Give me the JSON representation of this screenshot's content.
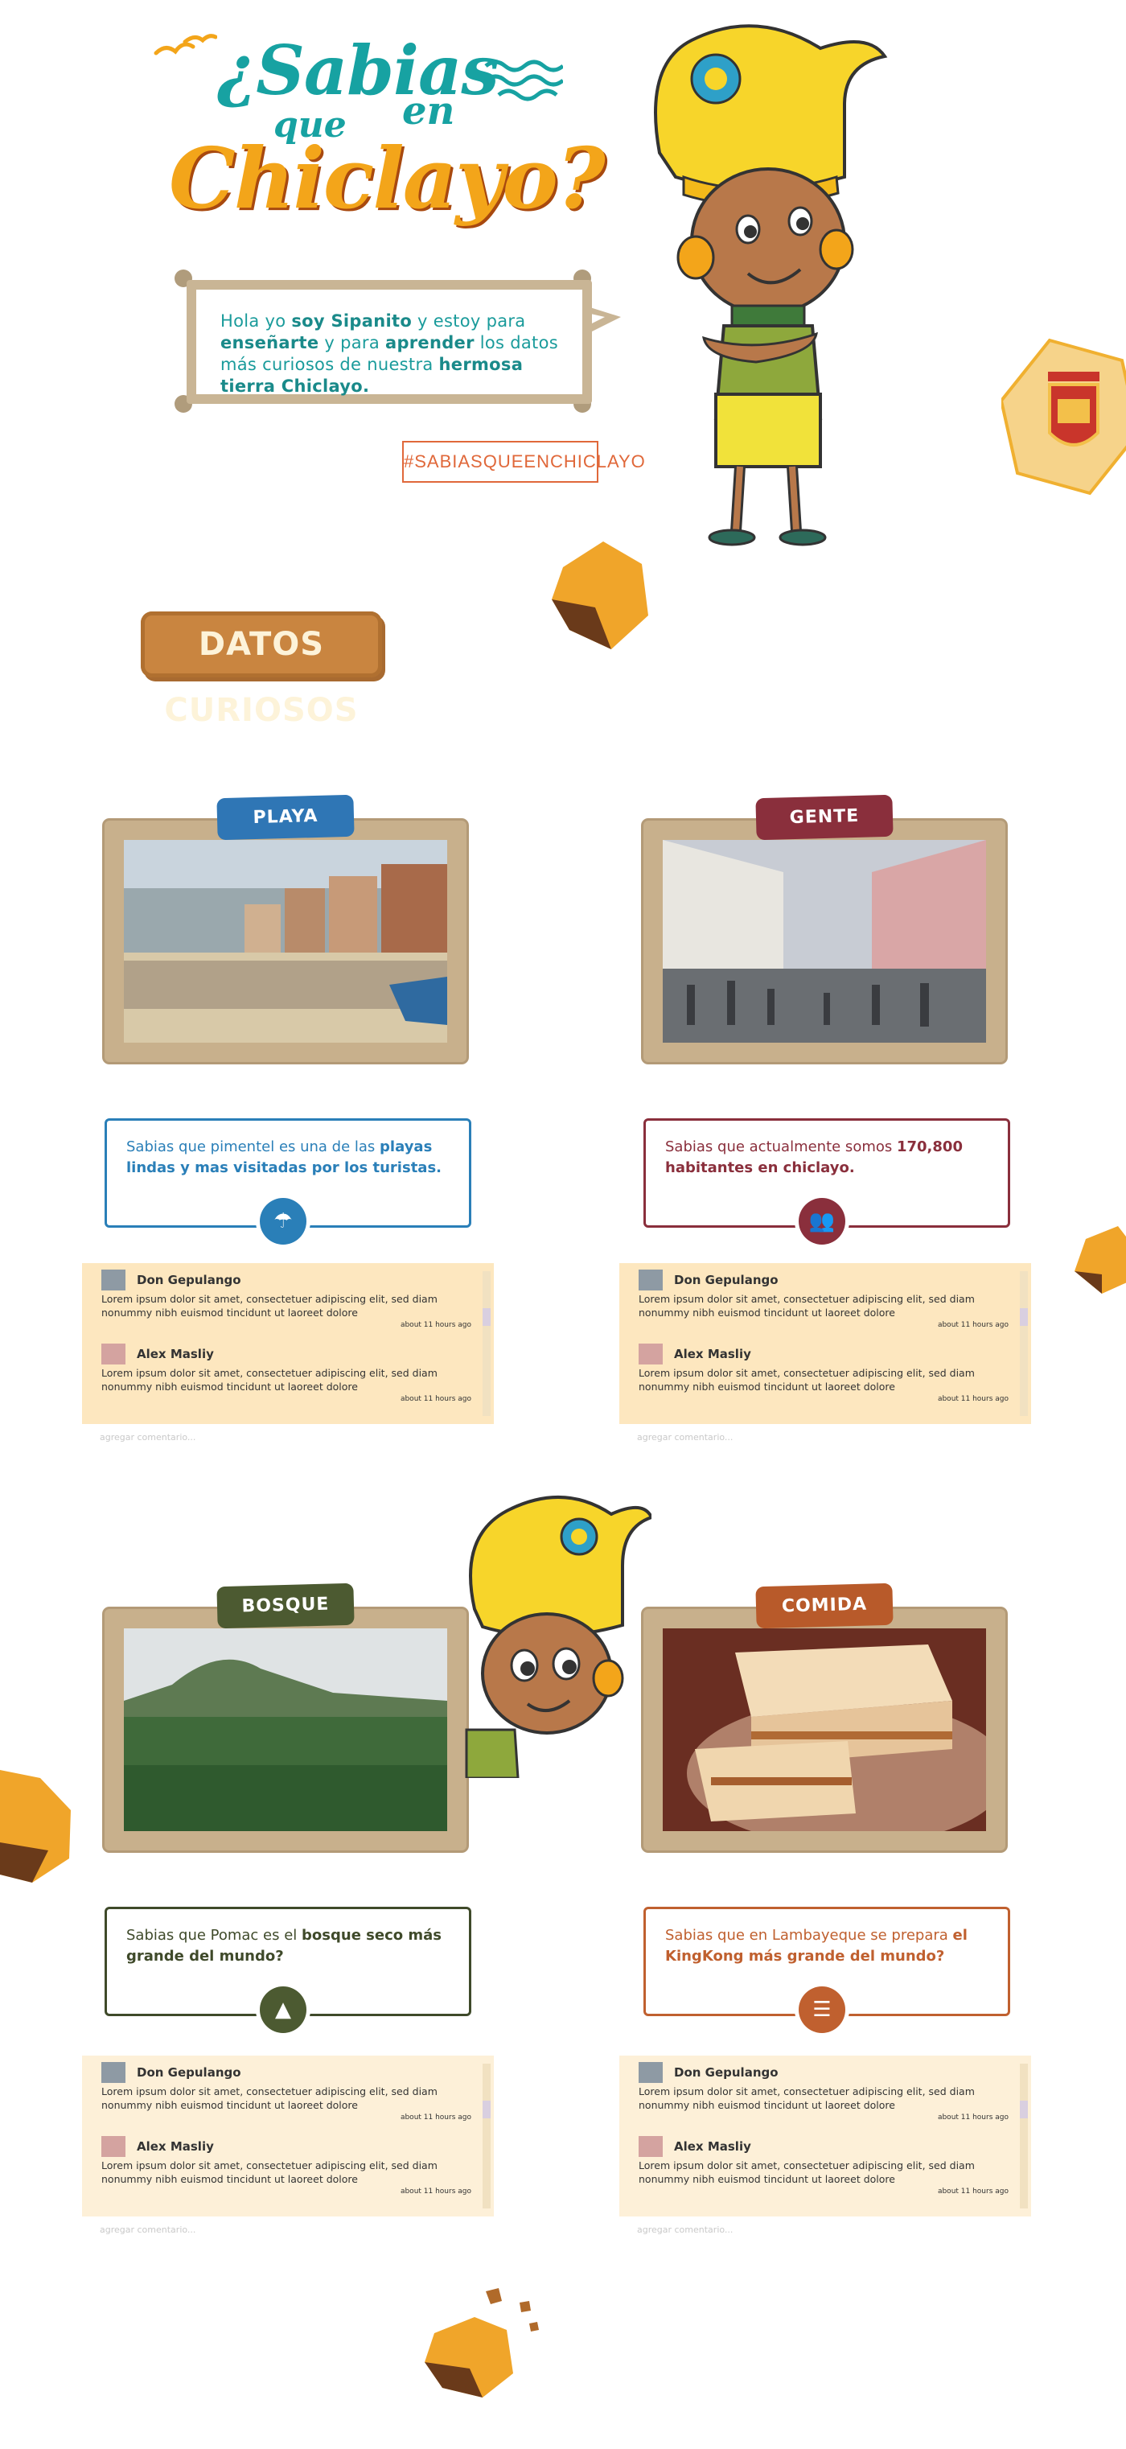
{
  "header": {
    "title_line1": "¿Sabias",
    "title_que": "que",
    "title_en": "en",
    "title_line3": "Chiclayo?"
  },
  "intro": {
    "text_parts": [
      "Hola yo ",
      "soy Sipanito",
      " y estoy para ",
      "enseñarte",
      " y para ",
      "aprender",
      " los datos más curiosos de nuestra ",
      "hermosa tierra Chiclayo."
    ],
    "hashtag": "#SABIASQUEENCHICLAYO"
  },
  "section_badge": "DATOS CURIOSOS",
  "cards": [
    {
      "tag": "PLAYA",
      "tag_color": "#2f76b5",
      "accent": "#2a7fb8",
      "fact_parts": [
        "Sabias que pimentel es una de las ",
        "playas lindas y mas visitadas por los turistas."
      ],
      "icon": "beach-icon"
    },
    {
      "tag": "GENTE",
      "tag_color": "#8a2f3c",
      "accent": "#8a2f3c",
      "fact_parts": [
        "Sabias que actualmente somos ",
        "170,800 habitantes en chiclayo."
      ],
      "icon": "people-icon"
    },
    {
      "tag": "BOSQUE",
      "tag_color": "#4c5a31",
      "accent": "#3f4a2a",
      "fact_parts": [
        "Sabias que Pomac es el ",
        "bosque seco más grande del mundo?"
      ],
      "icon": "tree-icon"
    },
    {
      "tag": "COMIDA",
      "tag_color": "#b85a2a",
      "accent": "#c0602f",
      "fact_parts": [
        "Sabias que en Lambayeque se prepara ",
        "el KingKong más grande del mundo?"
      ],
      "icon": "kingkong-icon"
    }
  ],
  "comments": [
    {
      "name": "Don Gepulango",
      "body": "Lorem ipsum dolor sit amet, consectetuer adipiscing elit, sed diam nonummy nibh euismod tincidunt ut laoreet dolore",
      "time": "about 11 hours ago"
    },
    {
      "name": "Alex Masliy",
      "body": "Lorem ipsum dolor sit amet, consectetuer adipiscing elit, sed diam nonummy nibh euismod tincidunt ut laoreet dolore",
      "time": "about 11 hours ago"
    }
  ],
  "add_comment_placeholder": "agregar comentario...",
  "colors": {
    "teal": "#17a2a2",
    "orange": "#f3a51a",
    "comment_bg": "#fde7bf",
    "frame": "#c8b08c"
  }
}
